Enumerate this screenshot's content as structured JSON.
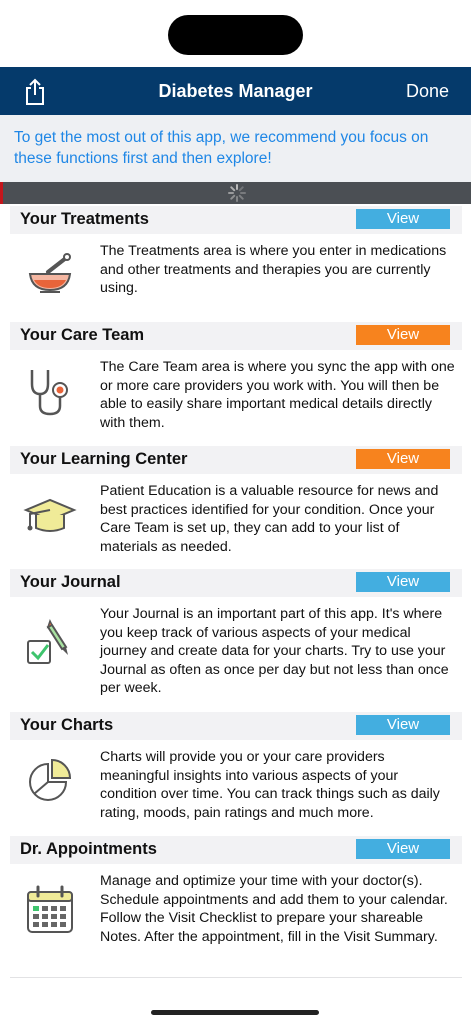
{
  "nav": {
    "title": "Diabetes Manager",
    "done_label": "Done",
    "share_icon": "share-icon"
  },
  "banner": {
    "text": "To get the most out of this app, we recommend you focus on these functions first and then explore!"
  },
  "colors": {
    "navbar": "#053a6b",
    "view_blue": "#43aee0",
    "view_orange": "#f7831e",
    "banner_text": "#1f87e6"
  },
  "sections": [
    {
      "title": "Your Treatments",
      "view_label": "View",
      "view_color": "blue",
      "icon": "mortar-pestle-icon",
      "description": "The Treatments area is where you enter in medications and other treatments and therapies you are currently using."
    },
    {
      "title": "Your Care Team",
      "view_label": "View",
      "view_color": "orange",
      "icon": "stethoscope-icon",
      "description": "The Care Team area is where you sync the app with one or more care providers you work with. You will then be able to easily share important medical details directly with them."
    },
    {
      "title": "Your Learning Center",
      "view_label": "View",
      "view_color": "orange",
      "icon": "graduation-cap-icon",
      "description": "Patient Education is a valuable resource for news and best practices identified for your condition. Once your Care Team is set up, they can add to your list of materials as needed."
    },
    {
      "title": "Your Journal",
      "view_label": "View",
      "view_color": "blue",
      "icon": "journal-pencil-icon",
      "description": "Your Journal is an important part of this app. It's where you keep track of various aspects of your medical journey and create data for your charts. Try to use your Journal as often as once per day but not less than once per week."
    },
    {
      "title": "Your Charts",
      "view_label": "View",
      "view_color": "blue",
      "icon": "pie-chart-icon",
      "description": "Charts will provide you or your care providers meaningful insights into various aspects of your condition over time. You can track things such as daily rating, moods, pain ratings and much more."
    },
    {
      "title": "Dr. Appointments",
      "view_label": "View",
      "view_color": "blue",
      "icon": "calendar-icon",
      "description": "Manage and optimize your time with your doctor(s). Schedule appointments and add them to your calendar. Follow the Visit Checklist to prepare your shareable Notes. After the appointment, fill in the Visit Summary."
    }
  ]
}
